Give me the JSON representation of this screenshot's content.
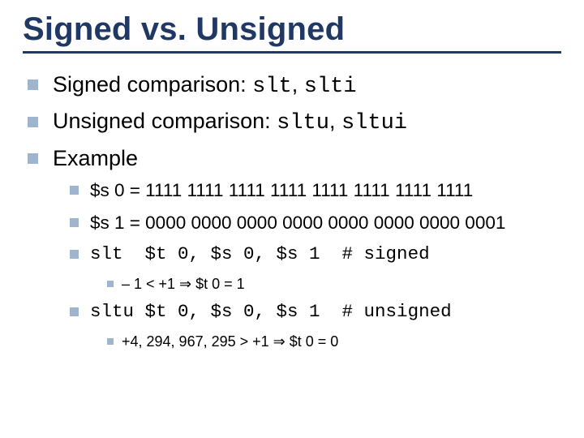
{
  "title": "Signed vs. Unsigned",
  "b1": {
    "pre": "Signed comparison: ",
    "code1": "slt",
    "sep": ", ",
    "code2": "slti"
  },
  "b2": {
    "pre": "Unsigned comparison: ",
    "code1": "sltu",
    "sep": ", ",
    "code2": "sltui"
  },
  "b3": "Example",
  "s1": "$s 0 = 1111 1111 1111 1111 1111 1111 1111 1111",
  "s2": "$s 1 = 0000 0000 0000 0000 0000 0000 0000 0001",
  "s3": {
    "code": "slt  $t 0, $s 0, $s 1  # signed"
  },
  "s3a": "– 1 < +1 ⇒ $t 0 = 1",
  "s4": {
    "code": "sltu $t 0, $s 0, $s 1  # unsigned"
  },
  "s4a": "+4, 294, 967, 295 > +1 ⇒ $t 0 = 0"
}
